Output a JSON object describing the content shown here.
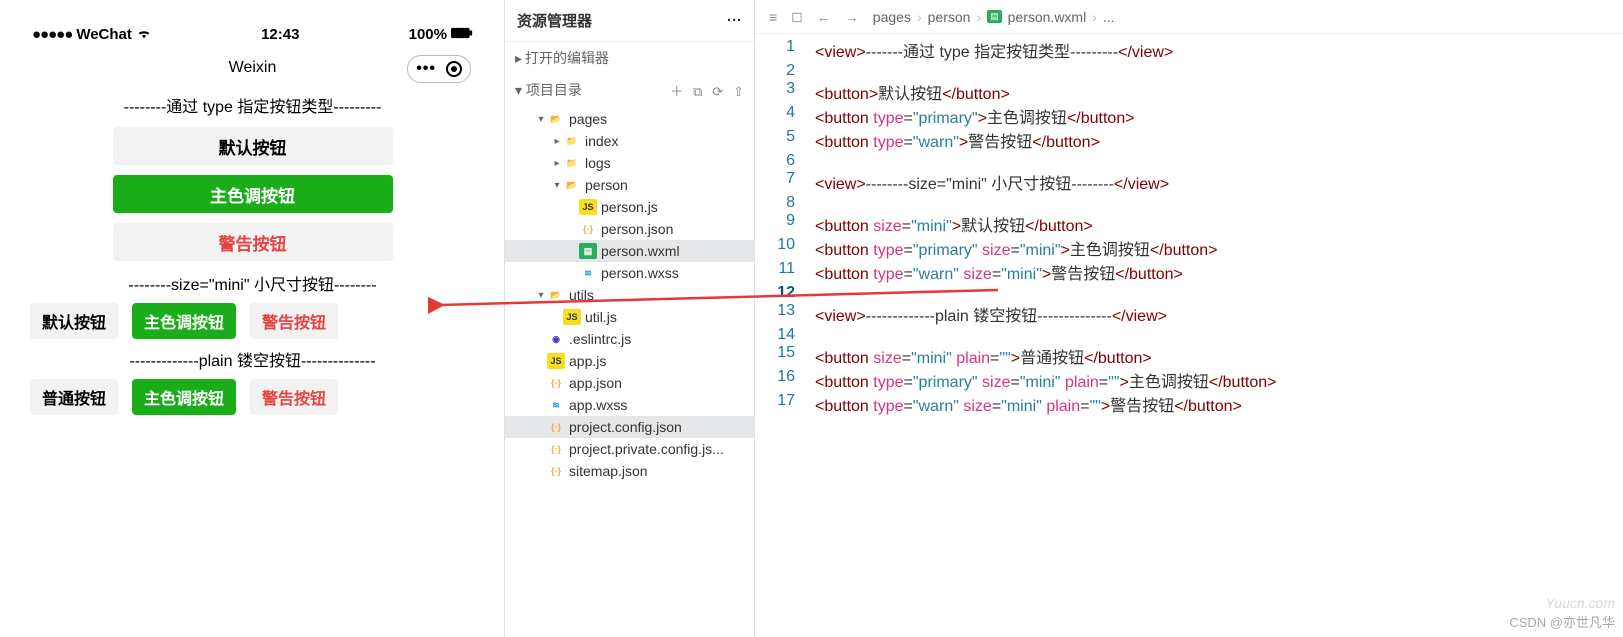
{
  "simulator": {
    "statusbar": {
      "carrier": "WeChat",
      "time": "12:43",
      "battery": "100%"
    },
    "navbar_title": "Weixin",
    "section1_title": "--------通过 type 指定按钮类型---------",
    "default_btn": "默认按钮",
    "primary_btn": "主色调按钮",
    "warn_btn": "警告按钮",
    "section2_title": "--------size=\"mini\" 小尺寸按钮--------",
    "mini_default": "默认按钮",
    "mini_primary": "主色调按钮",
    "mini_warn": "警告按钮",
    "section3_title": "-------------plain 镂空按钮--------------",
    "plain_default": "普通按钮",
    "plain_primary": "主色调按钮",
    "plain_warn": "警告按钮"
  },
  "explorer": {
    "title": "资源管理器",
    "open_editors": "打开的编辑器",
    "project_root": "项目目录",
    "actions": {
      "new_file": "＋",
      "new_folder": "⧉",
      "refresh": "⟳",
      "collapse": "⇧"
    },
    "tree": [
      {
        "name": "pages",
        "type": "folder-open",
        "depth": 1,
        "chev": "▾"
      },
      {
        "name": "index",
        "type": "folder",
        "depth": 2,
        "chev": "▸"
      },
      {
        "name": "logs",
        "type": "folder",
        "depth": 2,
        "chev": "▸"
      },
      {
        "name": "person",
        "type": "folder-open",
        "depth": 2,
        "chev": "▾"
      },
      {
        "name": "person.js",
        "type": "js",
        "depth": 3
      },
      {
        "name": "person.json",
        "type": "json",
        "depth": 3
      },
      {
        "name": "person.wxml",
        "type": "wxml",
        "depth": 3,
        "selected": true
      },
      {
        "name": "person.wxss",
        "type": "wxss",
        "depth": 3
      },
      {
        "name": "utils",
        "type": "folder-open",
        "depth": 1,
        "chev": "▾"
      },
      {
        "name": "util.js",
        "type": "js",
        "depth": 2
      },
      {
        "name": ".eslintrc.js",
        "type": "eslint",
        "depth": 1
      },
      {
        "name": "app.js",
        "type": "js",
        "depth": 1
      },
      {
        "name": "app.json",
        "type": "json",
        "depth": 1
      },
      {
        "name": "app.wxss",
        "type": "wxss",
        "depth": 1
      },
      {
        "name": "project.config.json",
        "type": "json",
        "depth": 1,
        "selected": true
      },
      {
        "name": "project.private.config.js...",
        "type": "json",
        "depth": 1
      },
      {
        "name": "sitemap.json",
        "type": "json",
        "depth": 1
      }
    ]
  },
  "editor": {
    "breadcrumb": [
      "pages",
      "person",
      "person.wxml",
      "..."
    ],
    "lines": [
      {
        "n": 1,
        "t": [
          [
            "tag",
            "<"
          ],
          [
            "tag",
            "view"
          ],
          [
            "tag",
            ">"
          ],
          [
            "txt",
            "-------通过 type 指定按钮类型---------"
          ],
          [
            "tag",
            "</"
          ],
          [
            "tag",
            "view"
          ],
          [
            "tag",
            ">"
          ]
        ]
      },
      {
        "n": 2,
        "t": []
      },
      {
        "n": 3,
        "t": [
          [
            "tag",
            "<"
          ],
          [
            "tag",
            "button"
          ],
          [
            "tag",
            ">"
          ],
          [
            "txt",
            "默认按钮"
          ],
          [
            "tag",
            "</"
          ],
          [
            "tag",
            "button"
          ],
          [
            "tag",
            ">"
          ]
        ]
      },
      {
        "n": 4,
        "t": [
          [
            "tag",
            "<"
          ],
          [
            "tag",
            "button"
          ],
          [
            "txt",
            " "
          ],
          [
            "attr",
            "type"
          ],
          [
            "txt",
            "="
          ],
          [
            "aval",
            "\"primary\""
          ],
          [
            "tag",
            ">"
          ],
          [
            "txt",
            "主色调按钮"
          ],
          [
            "tag",
            "</"
          ],
          [
            "tag",
            "button"
          ],
          [
            "tag",
            ">"
          ]
        ]
      },
      {
        "n": 5,
        "t": [
          [
            "tag",
            "<"
          ],
          [
            "tag",
            "button"
          ],
          [
            "txt",
            " "
          ],
          [
            "attr",
            "type"
          ],
          [
            "txt",
            "="
          ],
          [
            "aval",
            "\"warn\""
          ],
          [
            "tag",
            ">"
          ],
          [
            "txt",
            "警告按钮"
          ],
          [
            "tag",
            "</"
          ],
          [
            "tag",
            "button"
          ],
          [
            "tag",
            ">"
          ]
        ]
      },
      {
        "n": 6,
        "t": []
      },
      {
        "n": 7,
        "t": [
          [
            "tag",
            "<"
          ],
          [
            "tag",
            "view"
          ],
          [
            "tag",
            ">"
          ],
          [
            "txt",
            "--------size=\"mini\" 小尺寸按钮--------"
          ],
          [
            "tag",
            "</"
          ],
          [
            "tag",
            "view"
          ],
          [
            "tag",
            ">"
          ]
        ]
      },
      {
        "n": 8,
        "t": []
      },
      {
        "n": 9,
        "t": [
          [
            "tag",
            "<"
          ],
          [
            "tag",
            "button"
          ],
          [
            "txt",
            " "
          ],
          [
            "attr",
            "size"
          ],
          [
            "txt",
            "="
          ],
          [
            "aval",
            "\"mini\""
          ],
          [
            "tag",
            ">"
          ],
          [
            "txt",
            "默认按钮"
          ],
          [
            "tag",
            "</"
          ],
          [
            "tag",
            "button"
          ],
          [
            "tag",
            ">"
          ]
        ]
      },
      {
        "n": 10,
        "t": [
          [
            "tag",
            "<"
          ],
          [
            "tag",
            "button"
          ],
          [
            "txt",
            " "
          ],
          [
            "attr",
            "type"
          ],
          [
            "txt",
            "="
          ],
          [
            "aval",
            "\"primary\""
          ],
          [
            "txt",
            " "
          ],
          [
            "attr",
            "size"
          ],
          [
            "txt",
            "="
          ],
          [
            "aval",
            "\"mini\""
          ],
          [
            "tag",
            ">"
          ],
          [
            "txt",
            "主色调按钮"
          ],
          [
            "tag",
            "</"
          ],
          [
            "tag",
            "button"
          ],
          [
            "tag",
            ">"
          ]
        ]
      },
      {
        "n": 11,
        "t": [
          [
            "tag",
            "<"
          ],
          [
            "tag",
            "button"
          ],
          [
            "txt",
            " "
          ],
          [
            "attr",
            "type"
          ],
          [
            "txt",
            "="
          ],
          [
            "aval",
            "\"warn\""
          ],
          [
            "txt",
            " "
          ],
          [
            "attr",
            "size"
          ],
          [
            "txt",
            "="
          ],
          [
            "aval",
            "\"mini\""
          ],
          [
            "tag",
            ">"
          ],
          [
            "txt",
            "警告按钮"
          ],
          [
            "tag",
            "</"
          ],
          [
            "tag",
            "button"
          ],
          [
            "tag",
            ">"
          ]
        ]
      },
      {
        "n": 12,
        "t": [],
        "cur": true
      },
      {
        "n": 13,
        "t": [
          [
            "tag",
            "<"
          ],
          [
            "tag",
            "view"
          ],
          [
            "tag",
            ">"
          ],
          [
            "txt",
            "-------------plain 镂空按钮--------------"
          ],
          [
            "tag",
            "</"
          ],
          [
            "tag",
            "view"
          ],
          [
            "tag",
            ">"
          ]
        ]
      },
      {
        "n": 14,
        "t": []
      },
      {
        "n": 15,
        "t": [
          [
            "tag",
            "<"
          ],
          [
            "tag",
            "button"
          ],
          [
            "txt",
            " "
          ],
          [
            "attr",
            "size"
          ],
          [
            "txt",
            "="
          ],
          [
            "aval",
            "\"mini\""
          ],
          [
            "txt",
            " "
          ],
          [
            "attr",
            "plain"
          ],
          [
            "txt",
            "="
          ],
          [
            "aval",
            "\"\""
          ],
          [
            "tag",
            ">"
          ],
          [
            "txt",
            "普通按钮"
          ],
          [
            "tag",
            "</"
          ],
          [
            "tag",
            "button"
          ],
          [
            "tag",
            ">"
          ]
        ]
      },
      {
        "n": 16,
        "t": [
          [
            "tag",
            "<"
          ],
          [
            "tag",
            "button"
          ],
          [
            "txt",
            " "
          ],
          [
            "attr",
            "type"
          ],
          [
            "txt",
            "="
          ],
          [
            "aval",
            "\"primary\""
          ],
          [
            "txt",
            " "
          ],
          [
            "attr",
            "size"
          ],
          [
            "txt",
            "="
          ],
          [
            "aval",
            "\"mini\""
          ],
          [
            "txt",
            " "
          ],
          [
            "attr",
            "plain"
          ],
          [
            "txt",
            "="
          ],
          [
            "aval",
            "\"\""
          ],
          [
            "tag",
            ">"
          ],
          [
            "txt",
            "主色调按钮"
          ],
          [
            "tag",
            "</"
          ],
          [
            "tag",
            "button"
          ],
          [
            "tag",
            ">"
          ]
        ]
      },
      {
        "n": 17,
        "t": [
          [
            "tag",
            "<"
          ],
          [
            "tag",
            "button"
          ],
          [
            "txt",
            " "
          ],
          [
            "attr",
            "type"
          ],
          [
            "txt",
            "="
          ],
          [
            "aval",
            "\"warn\""
          ],
          [
            "txt",
            " "
          ],
          [
            "attr",
            "size"
          ],
          [
            "txt",
            "="
          ],
          [
            "aval",
            "\"mini\""
          ],
          [
            "txt",
            " "
          ],
          [
            "attr",
            "plain"
          ],
          [
            "txt",
            "="
          ],
          [
            "aval",
            "\"\""
          ],
          [
            "tag",
            ">"
          ],
          [
            "txt",
            "警告按钮"
          ],
          [
            "tag",
            "</"
          ],
          [
            "tag",
            "button"
          ],
          [
            "tag",
            ">"
          ]
        ]
      }
    ]
  },
  "watermark1": "Yuucn.com",
  "watermark2": "CSDN @亦世凡华"
}
